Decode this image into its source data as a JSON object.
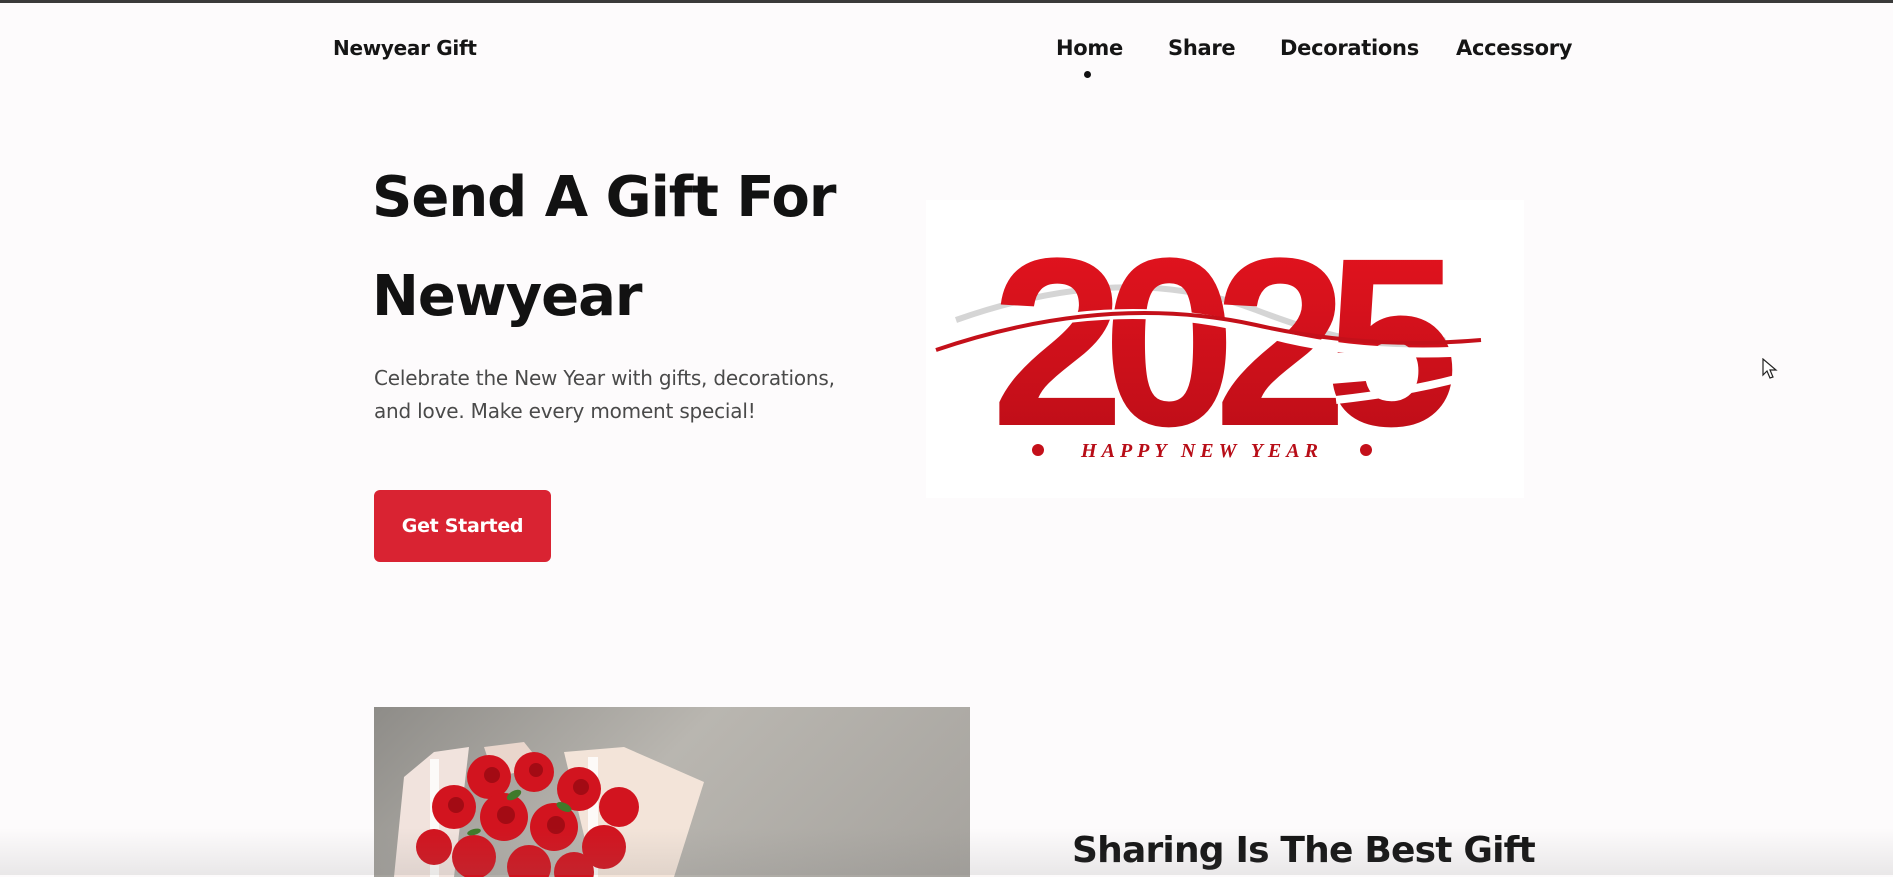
{
  "header": {
    "brand": "Newyear Gift",
    "nav": [
      {
        "label": "Home",
        "active": true
      },
      {
        "label": "Share"
      },
      {
        "label": "Decorations"
      },
      {
        "label": "Accessory"
      }
    ]
  },
  "hero": {
    "title_line1": "Send A Gift For",
    "title_line2": "Newyear",
    "description": "Celebrate the New Year with gifts, decorations, and love. Make every moment special!",
    "cta_label": "Get Started",
    "image": {
      "year": "2025",
      "caption": "HAPPY NEW YEAR"
    }
  },
  "share_section": {
    "title": "Sharing Is The Best Gift"
  },
  "colors": {
    "accent": "#d92332",
    "logo_red": "#d5121d",
    "background": "#fdfbfc"
  }
}
